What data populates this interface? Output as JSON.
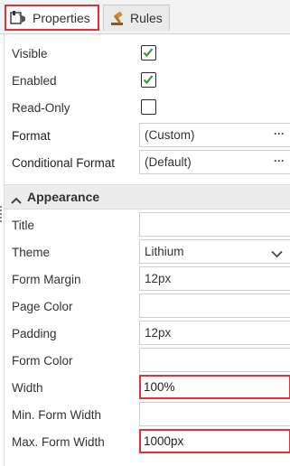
{
  "tabs": [
    {
      "label": "Properties",
      "icon": "properties-icon",
      "active": true
    },
    {
      "label": "Rules",
      "icon": "rules-gavel-icon",
      "active": false
    }
  ],
  "general": {
    "visible": {
      "label": "Visible",
      "checked": true
    },
    "enabled": {
      "label": "Enabled",
      "checked": true
    },
    "readonly": {
      "label": "Read-Only",
      "checked": false
    },
    "format": {
      "label": "Format",
      "value": "(Custom)"
    },
    "conditional_format": {
      "label": "Conditional Format",
      "value": "(Default)"
    }
  },
  "appearance": {
    "section_label": "Appearance",
    "title": {
      "label": "Title",
      "value": ""
    },
    "theme": {
      "label": "Theme",
      "value": "Lithium"
    },
    "form_margin": {
      "label": "Form Margin",
      "value": "12px"
    },
    "page_color": {
      "label": "Page Color",
      "value": ""
    },
    "padding": {
      "label": "Padding",
      "value": "12px"
    },
    "form_color": {
      "label": "Form Color",
      "value": ""
    },
    "width": {
      "label": "Width",
      "value": "100%"
    },
    "min_form_width": {
      "label": "Min. Form Width",
      "value": ""
    },
    "max_form_width": {
      "label": "Max. Form Width",
      "value": "1000px"
    }
  },
  "colors": {
    "highlight": "#e0313d",
    "check": "#3a9a3a"
  }
}
